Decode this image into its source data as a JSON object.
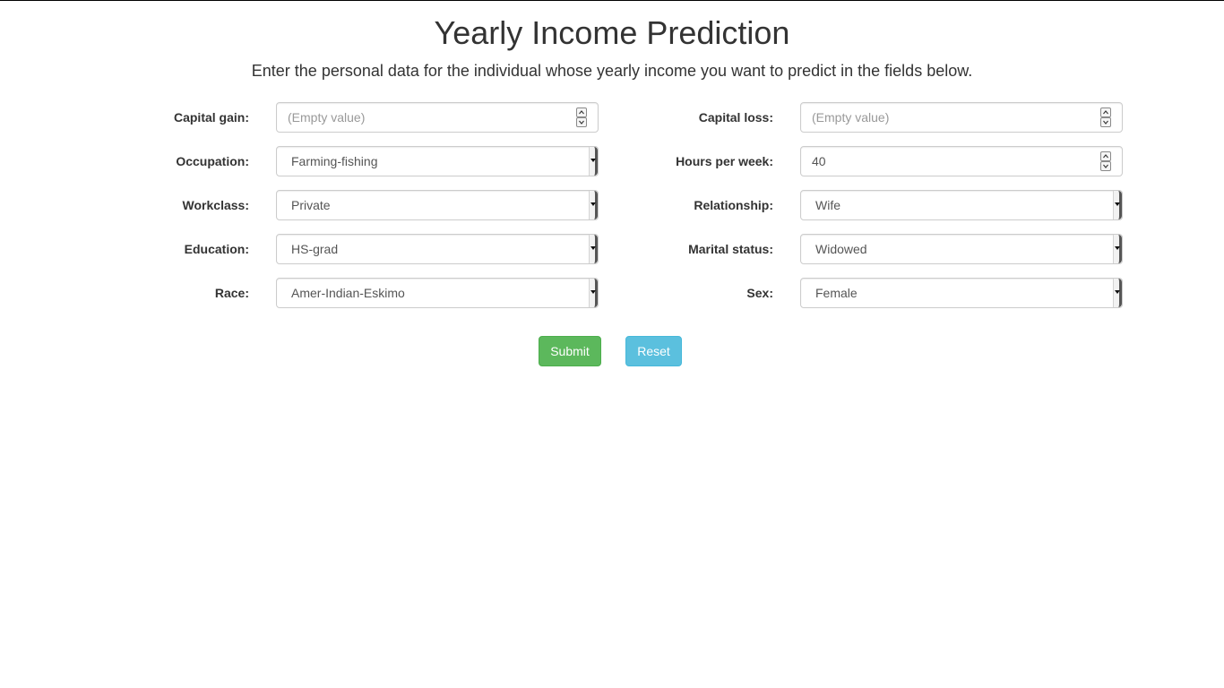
{
  "header": {
    "title": "Yearly Income Prediction",
    "subtitle": "Enter the personal data for the individual whose yearly income you want to predict in the fields below."
  },
  "form": {
    "capital_gain": {
      "label": "Capital gain:",
      "value": "",
      "placeholder": "(Empty value)"
    },
    "capital_loss": {
      "label": "Capital loss:",
      "value": "",
      "placeholder": "(Empty value)"
    },
    "occupation": {
      "label": "Occupation:",
      "value": "Farming-fishing"
    },
    "hours_per_week": {
      "label": "Hours per week:",
      "value": "40"
    },
    "workclass": {
      "label": "Workclass:",
      "value": "Private"
    },
    "relationship": {
      "label": "Relationship:",
      "value": "Wife"
    },
    "education": {
      "label": "Education:",
      "value": "HS-grad"
    },
    "marital_status": {
      "label": "Marital status:",
      "value": "Widowed"
    },
    "race": {
      "label": "Race:",
      "value": "Amer-Indian-Eskimo"
    },
    "sex": {
      "label": "Sex:",
      "value": "Female"
    }
  },
  "buttons": {
    "submit_label": "Submit",
    "reset_label": "Reset"
  },
  "colors": {
    "submit": "#5cb85c",
    "reset": "#5bc0de",
    "text": "#333333",
    "placeholder": "#999999"
  },
  "icons": {
    "spinner_up": "chevron-up-icon",
    "spinner_down": "chevron-down-icon",
    "select_caret": "caret-down-icon"
  }
}
